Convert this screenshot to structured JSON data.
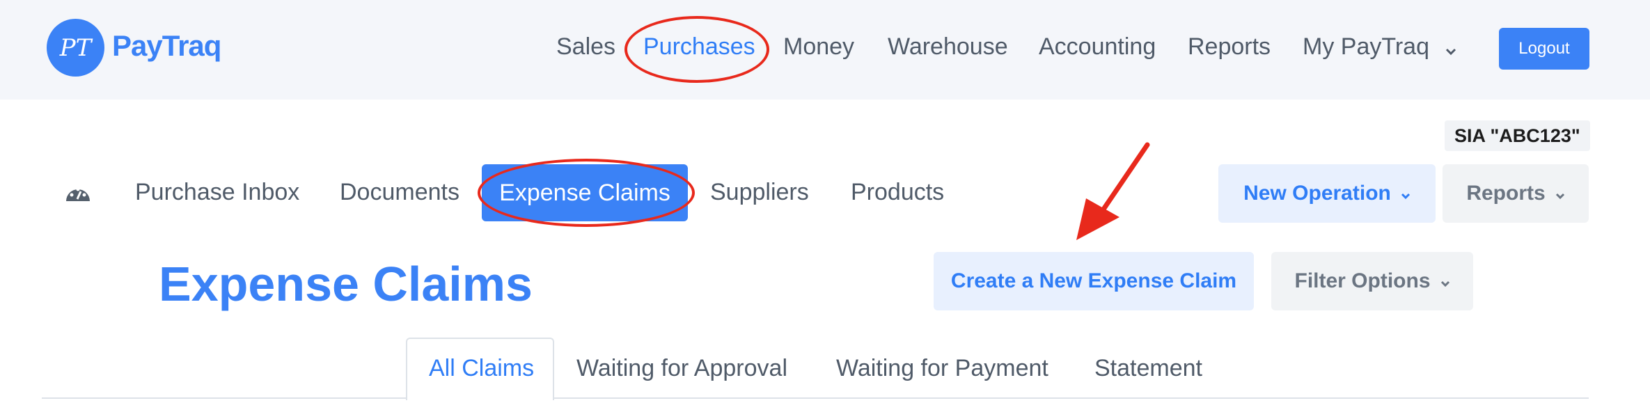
{
  "brand": {
    "logo_monogram": "PT",
    "name": "PayTraq",
    "accent_color": "#3b82f6",
    "annotation_color": "#e8291c"
  },
  "top_nav": {
    "items": [
      {
        "label": "Sales"
      },
      {
        "label": "Purchases",
        "active": true
      },
      {
        "label": "Money"
      },
      {
        "label": "Warehouse"
      },
      {
        "label": "Accounting"
      },
      {
        "label": "Reports"
      },
      {
        "label": "My PayTraq",
        "icon": "chevron-down-icon"
      }
    ],
    "logout_label": "Logout"
  },
  "company_name": "SIA \"ABC123\"",
  "sub_nav": {
    "dashboard_icon": "speedometer-icon",
    "items": [
      {
        "label": "Purchase Inbox"
      },
      {
        "label": "Documents"
      },
      {
        "label": "Expense Claims",
        "active": true
      },
      {
        "label": "Suppliers"
      },
      {
        "label": "Products"
      }
    ]
  },
  "actions": {
    "new_operation_label": "New Operation",
    "reports_label": "Reports",
    "create_label": "Create a New Expense Claim",
    "filter_label": "Filter Options"
  },
  "page_title": "Expense Claims",
  "tabs": [
    {
      "label": "All Claims",
      "active": true
    },
    {
      "label": "Waiting for Approval"
    },
    {
      "label": "Waiting for Payment"
    },
    {
      "label": "Statement"
    }
  ]
}
